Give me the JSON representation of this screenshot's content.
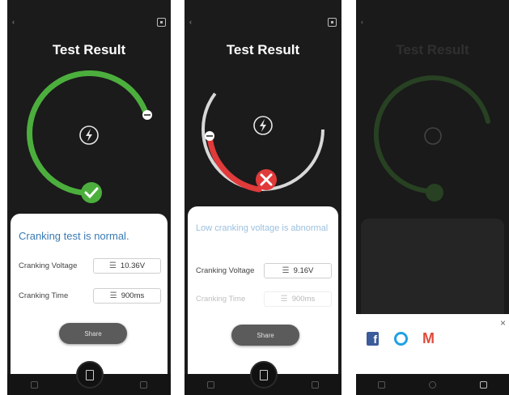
{
  "screens": [
    {
      "title": "Test Result",
      "result_message": "Cranking test is normal.",
      "rows": [
        {
          "label": "Cranking Voltage",
          "value": "10.36V"
        },
        {
          "label": "Cranking Time",
          "value": "900ms"
        }
      ],
      "share_label": "Share",
      "status_color": "#4caf3d",
      "status": "pass"
    },
    {
      "title": "Test Result",
      "result_message": "Low cranking voltage is abnormal",
      "rows": [
        {
          "label": "Cranking Voltage",
          "value": "9.16V"
        },
        {
          "label": "Cranking Time",
          "value": "900ms"
        }
      ],
      "share_label": "Share",
      "status_color": "#e03a3a",
      "status": "fail"
    },
    {
      "title": "Test Result",
      "share_targets": [
        "facebook-icon",
        "twitter-icon",
        "gmail-icon"
      ],
      "close_label": "×",
      "status_color": "#4caf3d"
    }
  ],
  "colors": {
    "accent_blue": "#3a7ab3",
    "pass_green": "#4caf3d",
    "fail_red": "#e03a3a",
    "arc_grey": "#cfcfcf"
  }
}
